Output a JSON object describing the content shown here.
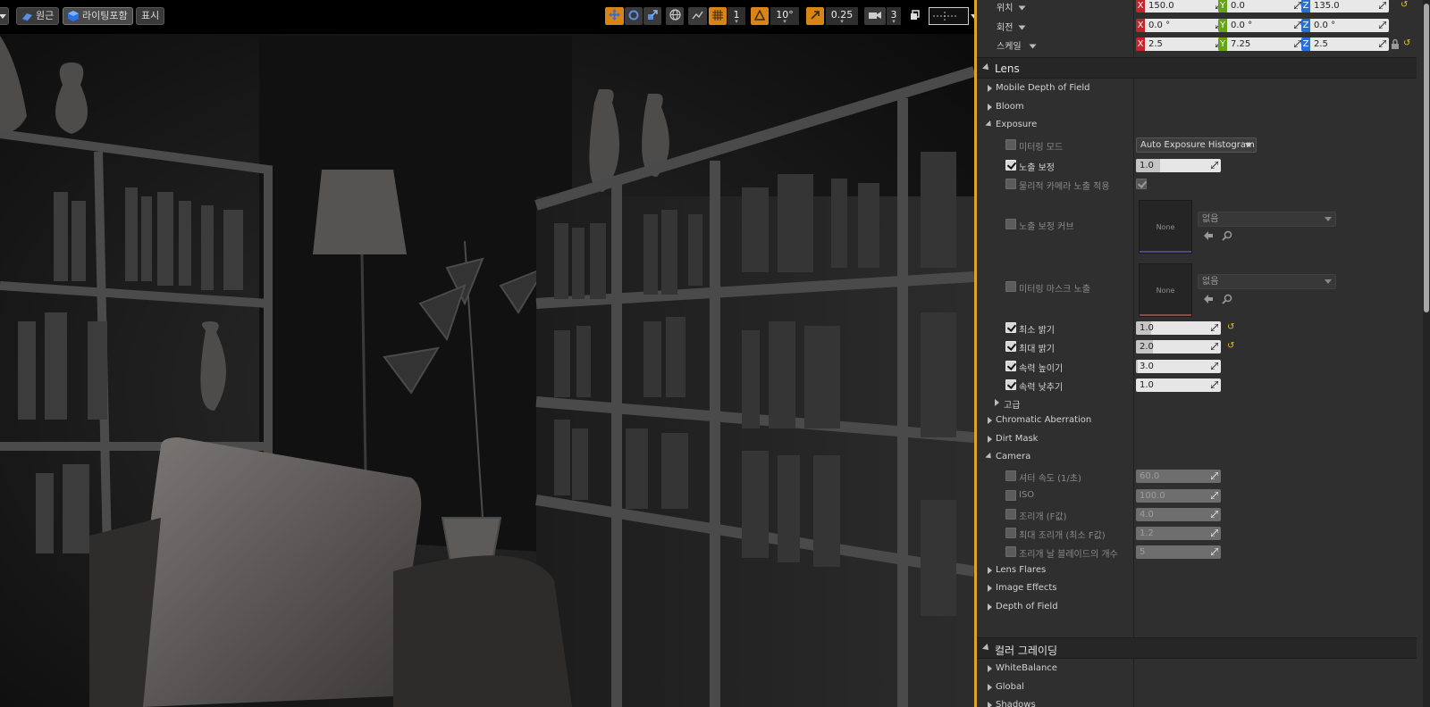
{
  "viewport_toolbar": {
    "perspective_label": "원근",
    "lit_label": "라이팅포함",
    "show_label": "표시",
    "grid_snap_value": "1",
    "rotation_snap_value": "10°",
    "scale_snap_value": "0.25",
    "camera_speed_value": "3"
  },
  "transform": {
    "location": {
      "label": "위치",
      "x": "150.0",
      "y": "0.0",
      "z": "135.0"
    },
    "rotation": {
      "label": "회전",
      "x": "0.0 °",
      "y": "0.0 °",
      "z": "0.0 °"
    },
    "scale": {
      "label": "스케일",
      "x": "2.5",
      "y": "7.25",
      "z": "2.5"
    }
  },
  "lens": {
    "title": "Lens",
    "mobile_dof": "Mobile Depth of Field",
    "bloom": "Bloom",
    "exposure": {
      "title": "Exposure",
      "metering_mode": {
        "label": "미터링 모드",
        "value": "Auto Exposure Histogram"
      },
      "exposure_compensation": {
        "label": "노출 보정",
        "value": "1.0"
      },
      "physical_camera_exposure": {
        "label": "물리적 카메라 노출 적용"
      },
      "exposure_curve": {
        "label": "노출 보정 커브",
        "thumb": "None",
        "asset": "없음"
      },
      "metering_mask": {
        "label": "미터링 마스크 노출",
        "thumb": "None",
        "asset": "없음"
      },
      "min_brightness": {
        "label": "최소 밝기",
        "value": "1.0"
      },
      "max_brightness": {
        "label": "최대 밝기",
        "value": "2.0"
      },
      "speed_up": {
        "label": "속력 높이기",
        "value": "3.0"
      },
      "speed_down": {
        "label": "속력 낮추기",
        "value": "1.0"
      },
      "advanced": "고급"
    },
    "chromatic_aberration": "Chromatic Aberration",
    "dirt_mask": "Dirt Mask",
    "camera": {
      "title": "Camera",
      "shutter_speed": {
        "label": "셔터 속도 (1/초)",
        "value": "60.0"
      },
      "iso": {
        "label": "ISO",
        "value": "100.0"
      },
      "aperture": {
        "label": "조리개 (F값)",
        "value": "4.0"
      },
      "max_aperture": {
        "label": "최대 조리개 (최소 F값)",
        "value": "1.2"
      },
      "blade_count": {
        "label": "조리개 날 블레이드의 개수",
        "value": "5"
      }
    },
    "lens_flares": "Lens Flares",
    "image_effects": "Image Effects",
    "depth_of_field": "Depth of Field"
  },
  "color_grading": {
    "title": "컬러 그레이딩",
    "white_balance": "WhiteBalance",
    "global": "Global",
    "shadows": "Shadows"
  },
  "colors": {
    "accent": "#e0a22e",
    "axis_x": "#c6242b",
    "axis_y": "#65a414",
    "axis_z": "#2a6fd6",
    "reset_arrow": "#e2c32a"
  },
  "progress": {
    "exposure_compensation_fill": 0.28,
    "min_brightness_fill": 0.18,
    "max_brightness_fill": 0.2,
    "speed_up_fill": 0.02
  }
}
